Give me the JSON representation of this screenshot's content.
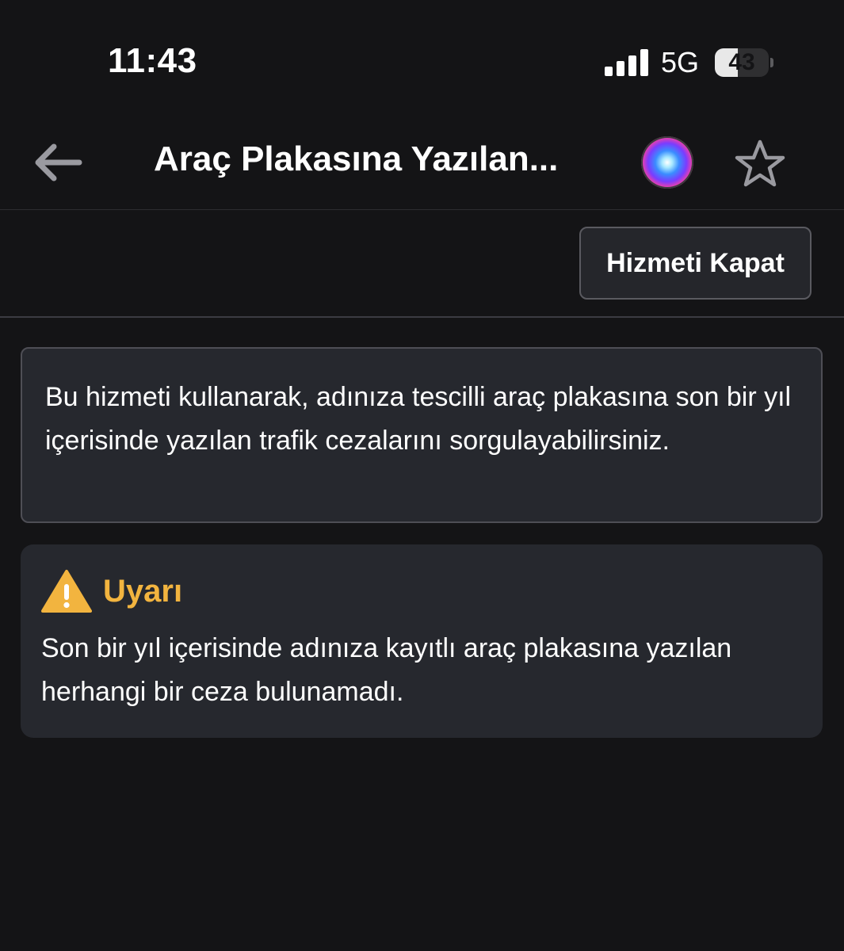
{
  "status_bar": {
    "time": "11:43",
    "network": "5G",
    "battery_level": "43",
    "battery_fraction": 0.43
  },
  "nav_bar": {
    "back_icon": "arrow-left-icon",
    "title": "Araç Plakasına Yazılan...",
    "siri_icon": "siri-icon",
    "favorite_icon": "star-outline-icon"
  },
  "toolbar": {
    "close_service_label": "Hizmeti Kapat"
  },
  "info": {
    "text": "Bu hizmeti kullanarak, adınıza tescilli araç plakasına son bir yıl içerisinde yazılan trafik cezalarını sorgulayabilirsiniz."
  },
  "warning": {
    "icon": "warning-triangle-icon",
    "title": "Uyarı",
    "text": "Son bir yıl içerisinde adınıza kayıtlı araç plakasına yazılan herhangi bir ceza bulunamadı."
  },
  "colors": {
    "background": "#141416",
    "card": "#26282e",
    "warning_accent": "#f2b43f",
    "text": "#ffffff"
  }
}
